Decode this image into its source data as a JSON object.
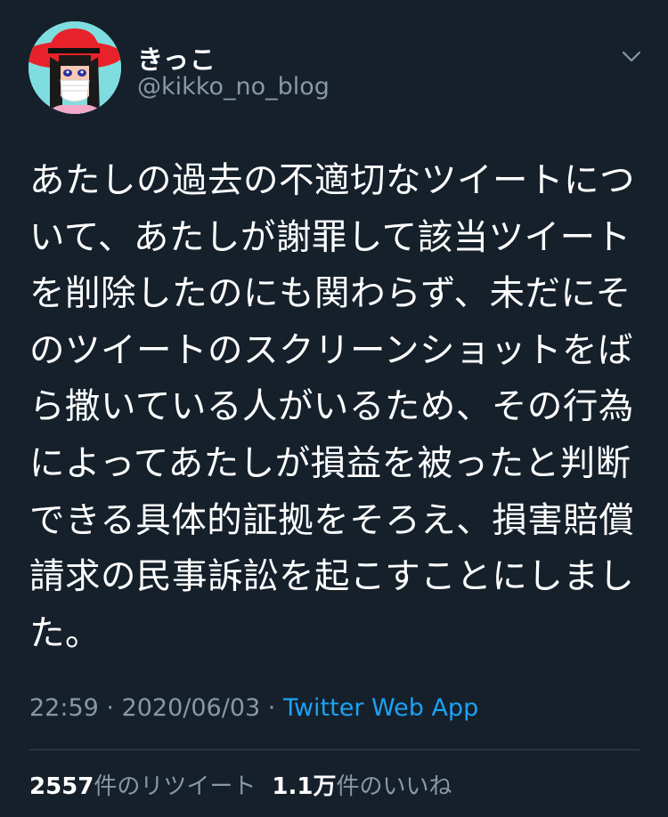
{
  "author": {
    "display_name": "きっこ",
    "handle": "@kikko_no_blog"
  },
  "tweet": {
    "text": "あたしの過去の不適切なツイートについて、あたしが謝罪して該当ツイートを削除したのにも関わらず、未だにそのツイートのスクリーンショットをばら撒いている人がいるため、その行為によってあたしが損益を被ったと判断できる具体的証拠をそろえ、損害賠償請求の民事訴訟を起こすことにしました。",
    "time": "22:59",
    "separator": " · ",
    "date": "2020/06/03",
    "source": "Twitter Web App"
  },
  "stats": {
    "retweets": "2557",
    "retweets_label": "件のリツイート",
    "likes": "1.1万",
    "likes_label": "件のいいね"
  },
  "icons": {
    "menu": "chevron-down-icon"
  },
  "colors": {
    "background": "#15202b",
    "secondary_text": "#8899a6",
    "link": "#1da1f2",
    "divider": "#38444d"
  }
}
